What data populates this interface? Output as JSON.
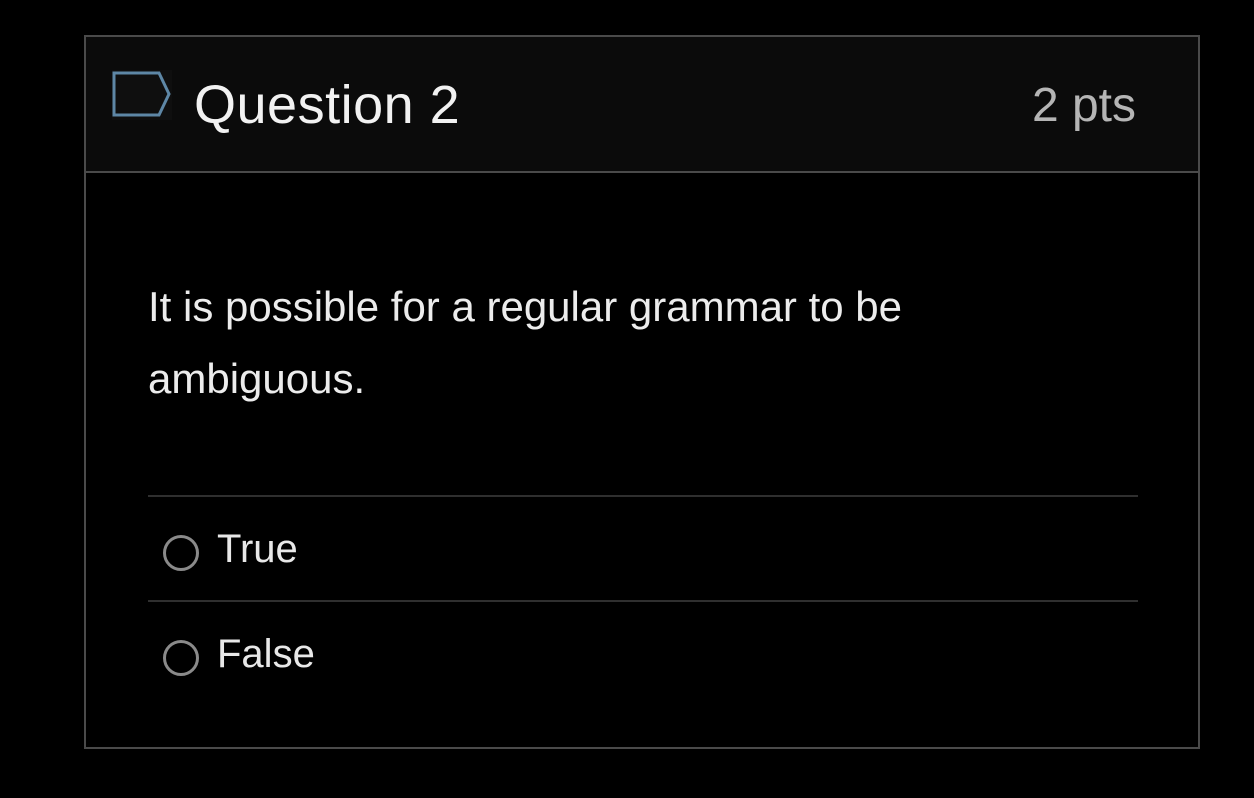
{
  "question": {
    "title": "Question 2",
    "points": "2 pts",
    "text": "It is possible for a regular grammar to be ambiguous.",
    "flag_icon": "flag-outline-icon",
    "answers": [
      {
        "label": "True",
        "selected": false
      },
      {
        "label": "False",
        "selected": false
      }
    ]
  },
  "colors": {
    "background": "#000000",
    "header_background": "#0b0b0b",
    "border": "#4a4a4a",
    "flag_stroke": "#5e87a6",
    "text": "#ececec",
    "points_text": "#b5b5b5"
  }
}
